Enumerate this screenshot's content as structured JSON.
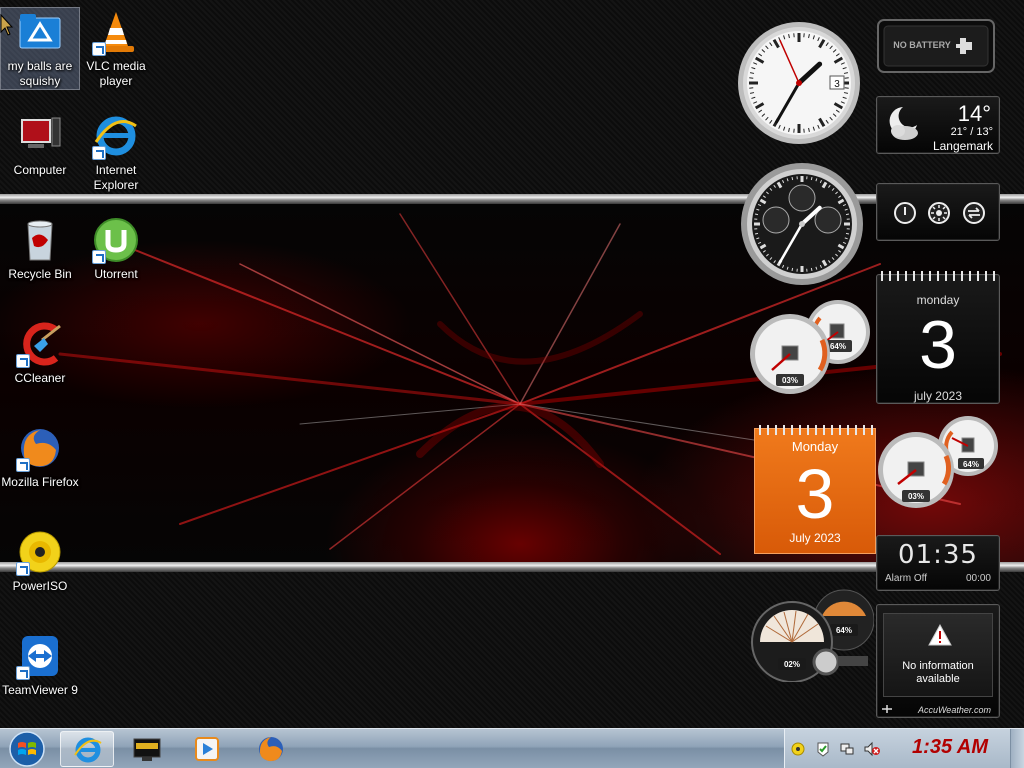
{
  "desktop": {
    "icons": [
      {
        "label": "my balls are squishy",
        "icon": "folder-sync-icon"
      },
      {
        "label": "VLC media player",
        "icon": "vlc-cone-icon"
      },
      {
        "label": "Computer",
        "icon": "computer-icon"
      },
      {
        "label": "Internet Explorer",
        "icon": "internet-explorer-icon"
      },
      {
        "label": "Recycle Bin",
        "icon": "recycle-bin-icon"
      },
      {
        "label": "Utorrent",
        "icon": "utorrent-icon"
      },
      {
        "label": "CCleaner",
        "icon": "ccleaner-icon"
      },
      {
        "label": "Mozilla Firefox",
        "icon": "firefox-icon"
      },
      {
        "label": "PowerISO",
        "icon": "poweriso-disc-icon"
      },
      {
        "label": "TeamViewer 9",
        "icon": "teamviewer-icon"
      }
    ]
  },
  "gadgets": {
    "clock": {
      "date_window": "3",
      "hour": 1,
      "minute": 35,
      "second": 56
    },
    "battery": {
      "label": "NO BATTERY"
    },
    "weather": {
      "temp": "14°",
      "range": "21° / 13°",
      "city": "Langemark",
      "icon": "moon-cloud-icon"
    },
    "chrono": {
      "hour": 1,
      "minute": 35
    },
    "power_buttons": {
      "icons": [
        "power-icon",
        "brightness-icon",
        "switch-icon"
      ]
    },
    "cpu_meter_1": {
      "left_value": "03%",
      "right_value": "64%"
    },
    "calendar_dark": {
      "day": "monday",
      "date": "3",
      "month": "july 2023"
    },
    "calendar_orange": {
      "day": "Monday",
      "date": "3",
      "month": "July 2023"
    },
    "cpu_meter_2": {
      "left_value": "03%",
      "right_value": "64%"
    },
    "alarm": {
      "time": "01:35",
      "label": "Alarm Off",
      "set_time": "00:00"
    },
    "cpu_meter_3": {
      "left_value": "02%",
      "right_value": "64%"
    },
    "accuweather": {
      "message_line1": "No information",
      "message_line2": "available",
      "brand": "AccuWeather.com",
      "icon": "warning-icon"
    }
  },
  "taskbar": {
    "start_icon": "windows-start-orb-icon",
    "pinned": [
      {
        "name": "internet-explorer",
        "icon": "internet-explorer-icon"
      },
      {
        "name": "media-center",
        "icon": "media-center-icon"
      },
      {
        "name": "media-player",
        "icon": "windows-media-player-icon"
      },
      {
        "name": "firefox",
        "icon": "firefox-icon"
      }
    ],
    "tray_icons": [
      "poweriso-tray-icon",
      "action-center-icon",
      "network-icon",
      "volume-muted-icon"
    ],
    "clock": "1:35 AM"
  },
  "colors": {
    "clock_red": "#b20000",
    "calendar_orange": "#e86a12",
    "accent_red": "#c00000"
  }
}
